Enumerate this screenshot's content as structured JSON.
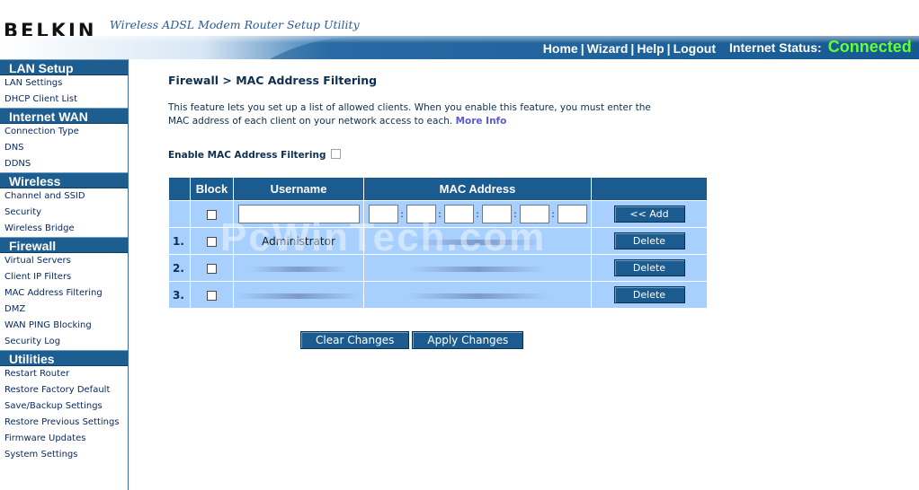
{
  "brand": "BELKIN",
  "tagline": "Wireless ADSL Modem Router Setup Utility",
  "top_nav": [
    "Home",
    "Wizard",
    "Help",
    "Logout"
  ],
  "status": {
    "label": "Internet Status:",
    "value": "Connected",
    "value_color": "#66ff33"
  },
  "sidebar": {
    "sections": [
      {
        "title": "LAN Setup",
        "items": [
          "LAN Settings",
          "DHCP Client List"
        ]
      },
      {
        "title": "Internet WAN",
        "items": [
          "Connection Type",
          "DNS",
          "DDNS"
        ]
      },
      {
        "title": "Wireless",
        "items": [
          "Channel and SSID",
          "Security",
          "Wireless Bridge"
        ]
      },
      {
        "title": "Firewall",
        "items": [
          "Virtual Servers",
          "Client IP Filters",
          "MAC Address Filtering",
          "DMZ",
          "WAN PING Blocking",
          "Security Log"
        ]
      },
      {
        "title": "Utilities",
        "items": [
          "Restart Router",
          "Restore Factory Default",
          "Save/Backup Settings",
          "Restore Previous Settings",
          "Firmware Updates",
          "System Settings"
        ]
      }
    ]
  },
  "main": {
    "title": "Firewall > MAC Address Filtering",
    "description_line1": "This feature lets you set up a list of allowed clients. When you enable this feature, you must enter the",
    "description_line2": "MAC address of each client on your network access to each.",
    "more_info": "More Info",
    "enable_label": "Enable MAC Address Filtering",
    "table": {
      "headers": [
        "",
        "Block",
        "Username",
        "MAC Address",
        ""
      ],
      "add_button": "<< Add",
      "rows": [
        {
          "index": "1.",
          "username": "Administrator",
          "delete": "Delete"
        },
        {
          "index": "2.",
          "username": "",
          "delete": "Delete"
        },
        {
          "index": "3.",
          "username": "",
          "delete": "Delete"
        }
      ]
    },
    "clear_button": "Clear Changes",
    "apply_button": "Apply Changes",
    "watermark": "PcWinTech.com"
  },
  "colors": {
    "header_blue": "#1b5b90",
    "table_cell": "#a8d0ff",
    "link_purple": "#5a5ad0"
  }
}
